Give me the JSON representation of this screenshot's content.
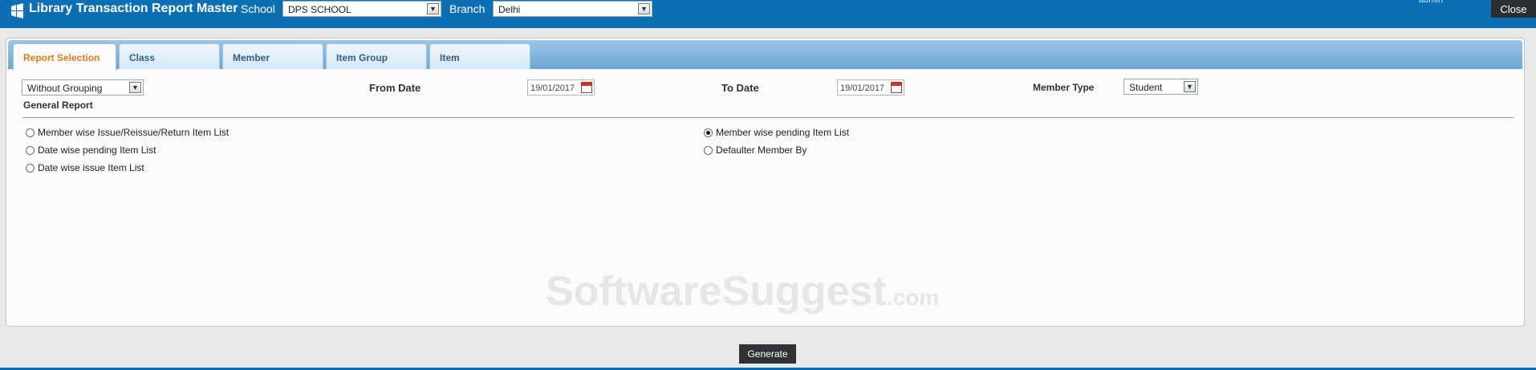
{
  "header": {
    "title": "Library Transaction Report Master",
    "school_label": "School",
    "school_value": "DPS SCHOOL",
    "branch_label": "Branch",
    "branch_value": "Delhi",
    "user": "admin",
    "close_label": "Close"
  },
  "tabs": [
    {
      "label": "Report Selection",
      "active": true
    },
    {
      "label": "Class",
      "active": false
    },
    {
      "label": "Member",
      "active": false
    },
    {
      "label": "Item Group",
      "active": false
    },
    {
      "label": "Item",
      "active": false
    }
  ],
  "filters": {
    "grouping_value": "Without Grouping",
    "from_date_label": "From Date",
    "from_date_value": "19/01/2017",
    "to_date_label": "To Date",
    "to_date_value": "19/01/2017",
    "member_type_label": "Member Type",
    "member_type_value": "Student"
  },
  "section_title": "General Report",
  "reports": [
    {
      "label": "Member wise Issue/Reissue/Return Item List",
      "selected": false
    },
    {
      "label": "Date wise pending Item List",
      "selected": false
    },
    {
      "label": "Date wise issue Item List",
      "selected": false
    },
    {
      "label": "Member wise pending Item List",
      "selected": true
    },
    {
      "label": "Defaulter Member By",
      "selected": false
    }
  ],
  "watermark": {
    "main": "SoftwareSuggest",
    "suffix": ".com"
  },
  "generate_label": "Generate",
  "colors": {
    "header_blue": "#0a6fb3",
    "active_tab": "#e27b1d",
    "dark_button": "#2f3337"
  }
}
